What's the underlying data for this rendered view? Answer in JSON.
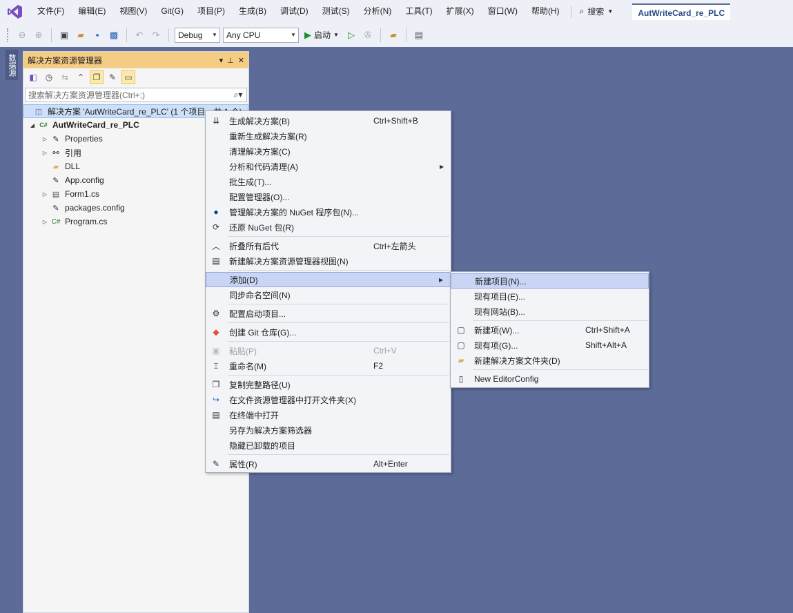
{
  "menubar": {
    "items": [
      "文件(F)",
      "编辑(E)",
      "视图(V)",
      "Git(G)",
      "项目(P)",
      "生成(B)",
      "调试(D)",
      "测试(S)",
      "分析(N)",
      "工具(T)",
      "扩展(X)",
      "窗口(W)",
      "帮助(H)"
    ],
    "search_label": "搜索",
    "solution_name": "AutWriteCard_re_PLC"
  },
  "toolbar": {
    "config_value": "Debug",
    "platform_value": "Any CPU",
    "run_label": "启动"
  },
  "side_tab": {
    "label": "数据源"
  },
  "explorer": {
    "title": "解决方案资源管理器",
    "search_placeholder": "搜索解决方案资源管理器(Ctrl+;)",
    "nodes": [
      {
        "label": "解决方案 'AutWriteCard_re_PLC' (1 个项目，共 1 个)",
        "icon": "solution-icon"
      },
      {
        "label": "AutWriteCard_re_PLC",
        "icon": "csharp-project-icon"
      },
      {
        "label": "Properties",
        "icon": "wrench-icon"
      },
      {
        "label": "引用",
        "icon": "references-icon"
      },
      {
        "label": "DLL",
        "icon": "folder-icon"
      },
      {
        "label": "App.config",
        "icon": "config-file-icon"
      },
      {
        "label": "Form1.cs",
        "icon": "form-icon"
      },
      {
        "label": "packages.config",
        "icon": "config-file-icon"
      },
      {
        "label": "Program.cs",
        "icon": "csharp-file-icon"
      }
    ]
  },
  "context_menu": {
    "items": [
      {
        "label": "生成解决方案(B)",
        "shortcut": "Ctrl+Shift+B",
        "icon": "build-icon"
      },
      {
        "label": "重新生成解决方案(R)",
        "shortcut": ""
      },
      {
        "label": "清理解决方案(C)",
        "shortcut": ""
      },
      {
        "label": "分析和代码清理(A)",
        "shortcut": "",
        "submenu": true
      },
      {
        "label": "批生成(T)...",
        "shortcut": ""
      },
      {
        "label": "配置管理器(O)...",
        "shortcut": ""
      },
      {
        "label": "管理解决方案的 NuGet 程序包(N)...",
        "shortcut": "",
        "icon": "nuget-icon"
      },
      {
        "label": "还原 NuGet 包(R)",
        "shortcut": "",
        "icon": "restore-icon"
      },
      {
        "label": "折叠所有后代",
        "shortcut": "Ctrl+左箭头",
        "icon": "collapse-icon"
      },
      {
        "label": "新建解决方案资源管理器视图(N)",
        "shortcut": "",
        "icon": "new-view-icon"
      },
      {
        "label": "添加(D)",
        "shortcut": "",
        "submenu": true
      },
      {
        "label": "同步命名空间(N)",
        "shortcut": ""
      },
      {
        "label": "配置启动项目...",
        "shortcut": "",
        "icon": "gear-icon"
      },
      {
        "label": "创建 Git 仓库(G)...",
        "shortcut": "",
        "icon": "git-icon"
      },
      {
        "label": "粘贴(P)",
        "shortcut": "Ctrl+V",
        "icon": "paste-icon",
        "disabled": true
      },
      {
        "label": "重命名(M)",
        "shortcut": "F2",
        "icon": "rename-icon"
      },
      {
        "label": "复制完整路径(U)",
        "shortcut": "",
        "icon": "copy-icon"
      },
      {
        "label": "在文件资源管理器中打开文件夹(X)",
        "shortcut": "",
        "icon": "open-folder-icon"
      },
      {
        "label": "在终端中打开",
        "shortcut": "",
        "icon": "terminal-icon"
      },
      {
        "label": "另存为解决方案筛选器",
        "shortcut": ""
      },
      {
        "label": "隐藏已卸载的项目",
        "shortcut": ""
      },
      {
        "label": "属性(R)",
        "shortcut": "Alt+Enter",
        "icon": "wrench-icon"
      }
    ]
  },
  "add_submenu": {
    "items": [
      {
        "label": "新建项目(N)...",
        "shortcut": ""
      },
      {
        "label": "现有项目(E)...",
        "shortcut": ""
      },
      {
        "label": "现有网站(B)...",
        "shortcut": ""
      },
      {
        "label": "新建项(W)...",
        "shortcut": "Ctrl+Shift+A",
        "icon": "new-item-icon"
      },
      {
        "label": "现有项(G)...",
        "shortcut": "Shift+Alt+A",
        "icon": "existing-item-icon"
      },
      {
        "label": "新建解决方案文件夹(D)",
        "shortcut": "",
        "icon": "new-folder-icon"
      },
      {
        "label": "New EditorConfig",
        "shortcut": "",
        "icon": "file-icon"
      }
    ]
  },
  "colors": {
    "background": "#5d6b99",
    "chrome": "#eef0f7",
    "explorer_header": "#f5cc84",
    "menu_highlight": "#c9d5f5"
  }
}
